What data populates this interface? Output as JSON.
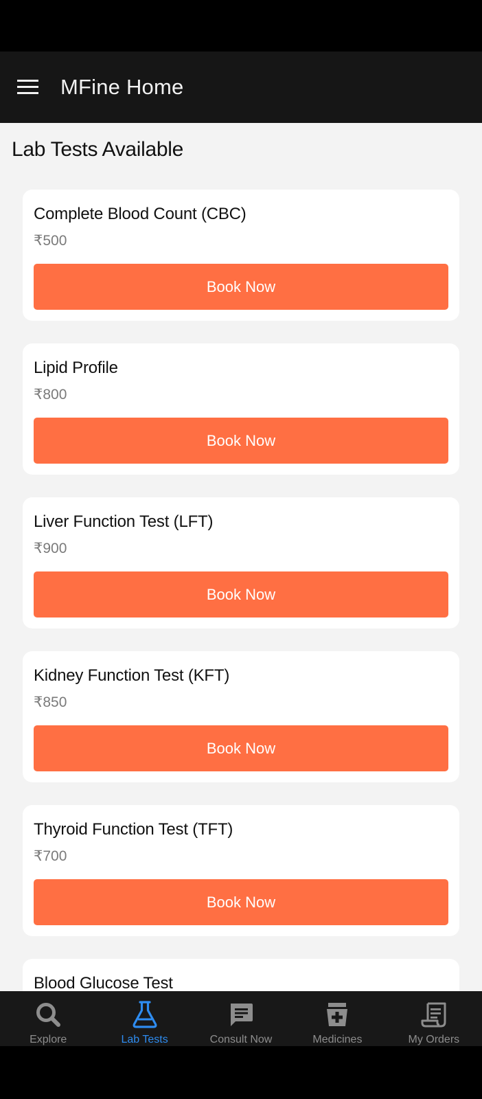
{
  "app": {
    "title": "MFine Home"
  },
  "section": {
    "title": "Lab Tests Available"
  },
  "tests": [
    {
      "name": "Complete Blood Count (CBC)",
      "price": "₹500",
      "button": "Book Now"
    },
    {
      "name": "Lipid Profile",
      "price": "₹800",
      "button": "Book Now"
    },
    {
      "name": "Liver Function Test (LFT)",
      "price": "₹900",
      "button": "Book Now"
    },
    {
      "name": "Kidney Function Test (KFT)",
      "price": "₹850",
      "button": "Book Now"
    },
    {
      "name": "Thyroid Function Test (TFT)",
      "price": "₹700",
      "button": "Book Now"
    },
    {
      "name": "Blood Glucose Test"
    }
  ],
  "bottom_nav": {
    "items": [
      {
        "label": "Explore",
        "icon": "search-icon",
        "active": false
      },
      {
        "label": "Lab Tests",
        "icon": "flask-icon",
        "active": true
      },
      {
        "label": "Consult Now",
        "icon": "chat-icon",
        "active": false
      },
      {
        "label": "Medicines",
        "icon": "medicine-icon",
        "active": false
      },
      {
        "label": "My Orders",
        "icon": "receipt-icon",
        "active": false
      }
    ]
  },
  "colors": {
    "accent": "#ff6f43",
    "active_nav": "#2e8cf0",
    "app_bar": "#161616",
    "background": "#f3f3f3"
  }
}
